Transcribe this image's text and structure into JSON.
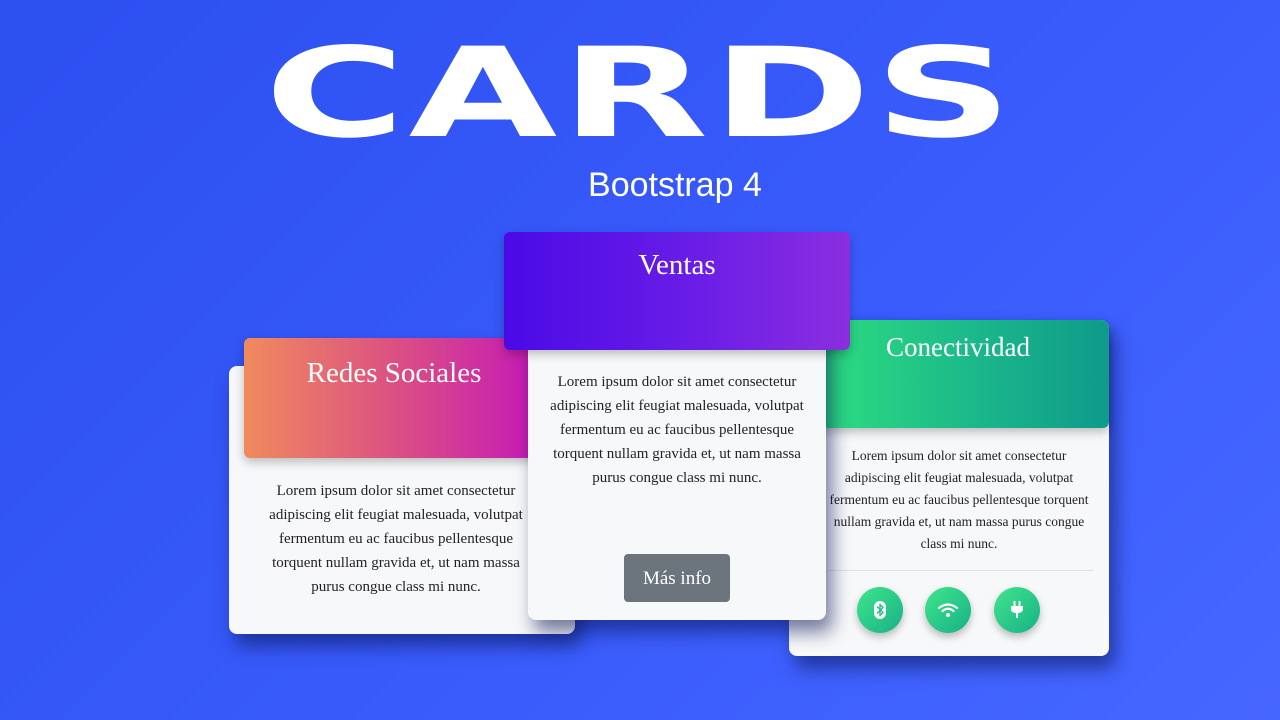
{
  "hero": {
    "title": "CARDS",
    "subtitle": "Bootstrap 4"
  },
  "cards": {
    "left": {
      "title": "Redes Sociales",
      "body": "Lorem ipsum dolor sit amet consectetur adipiscing elit feugiat malesuada, volutpat fermentum eu ac faucibus pellentesque torquent nullam gravida et, ut nam massa purus congue class mi nunc."
    },
    "center": {
      "title": "Ventas",
      "body": "Lorem ipsum dolor sit amet consectetur adipiscing elit feugiat malesuada, volutpat fermentum eu ac faucibus pellentesque torquent nullam gravida et, ut nam massa purus congue class mi nunc.",
      "button_label": "Más info"
    },
    "right": {
      "title": "Conectividad",
      "body": "Lorem ipsum dolor sit amet consectetur adipiscing elit feugiat malesuada, volutpat fermentum eu ac faucibus pellentesque torquent nullam gravida et, ut nam massa purus congue class mi nunc.",
      "icons": [
        "bluetooth-icon",
        "wifi-icon",
        "plug-icon"
      ]
    }
  },
  "colors": {
    "background": "#3a5cfc",
    "left_header": [
      "#f08a5d",
      "#c417b9"
    ],
    "center_header": [
      "#4a0ae6",
      "#8b2ee0"
    ],
    "right_header": [
      "#2fe07f",
      "#0f9a8a"
    ],
    "button": "#6c757d"
  }
}
